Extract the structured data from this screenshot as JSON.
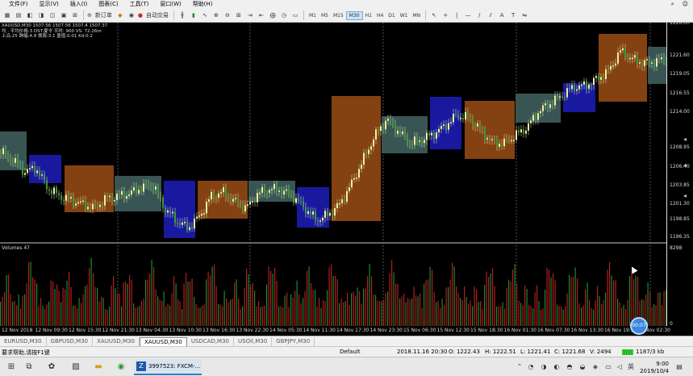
{
  "menu": {
    "items": [
      "文件(F)",
      "显示(V)",
      "插入(I)",
      "图表(C)",
      "工具(T)",
      "窗口(W)",
      "帮助(H)"
    ],
    "right_icons": [
      "search-icon",
      "user-icon"
    ]
  },
  "toolbar": {
    "new_order_label": "新订单",
    "autotrade_label": "自动交易",
    "timeframes": [
      "M1",
      "M5",
      "M15",
      "M30",
      "H1",
      "H4",
      "D1",
      "W1",
      "MN"
    ],
    "active_timeframe": "M30"
  },
  "chart_info": {
    "line1": "XAUUSD,M30  1507.56 1507.56 1507.4 1507.37",
    "line2": "均 · 平均价格:3  DST:夏令  平时:  900  VS:   72.26m",
    "line3": "上沿:25  跨幅:4.8  换周:3.1  盈值:0.01  Kd:0.2",
    "volume_label": "Volumes 47"
  },
  "price_axis": [
    "1226.00",
    "1221.60",
    "1219.05",
    "1216.55",
    "1214.00",
    "1208.95",
    "1206.40",
    "1203.85",
    "1201.30",
    "1198.85",
    "1196.35",
    "8298",
    "0"
  ],
  "time_axis": [
    "12 Nov 2018",
    "12 Nov 09:30",
    "12 Nov 15:30",
    "12 Nov 21:30",
    "13 Nov 04:30",
    "13 Nov 10:30",
    "13 Nov 16:30",
    "13 Nov 22:30",
    "14 Nov 05:30",
    "14 Nov 11:30",
    "14 Nov 17:30",
    "14 Nov 23:30",
    "15 Nov 06:30",
    "15 Nov 12:30",
    "15 Nov 18:30",
    "16 Nov 01:30",
    "16 Nov 07:30",
    "16 Nov 13:30",
    "16 Nov 19:30",
    "19 Nov 02:30"
  ],
  "tabs": [
    "EURUSD,M30",
    "GBPUSD,M30",
    "XAUUSD,M30",
    "XAUUSD,M30",
    "USDCAD,M30",
    "USOil,M30",
    "GBPJPY,M30"
  ],
  "active_tab": 3,
  "status": {
    "help": "要求帮助,请按F1键",
    "profile": "Default",
    "time": "2018.11.16 20:30",
    "open": "O: 1222.43",
    "high": "H: 1222.51",
    "low": "L: 1221.41",
    "close": "C: 1221.68",
    "volume": "V: 2494",
    "traffic": "1187/3 kb"
  },
  "taskbar": {
    "app_label": "3997523: FXCM-...",
    "time": "9:00",
    "date": "2019/10/4",
    "ime": "英"
  },
  "record_button": "00:07",
  "colors": {
    "bull": "#2ea043",
    "bear": "#d03030",
    "box_up": "#8b4513",
    "box_down": "#1a1aa8",
    "box_flat": "#3b5a58"
  }
}
